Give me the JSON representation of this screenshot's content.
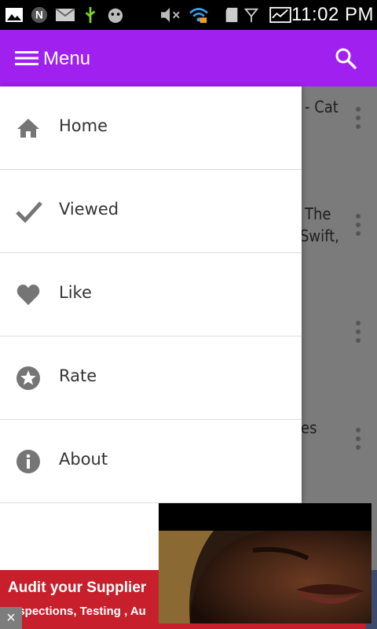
{
  "status_bar": {
    "time": "11:02 PM",
    "icons": [
      "image-icon",
      "n-icon",
      "mail-icon",
      "usb-icon",
      "android-debug-icon",
      "mute-icon",
      "wifi-icon",
      "sd-card-icon",
      "signal-icon",
      "activity-icon"
    ]
  },
  "app_bar": {
    "title": "Menu",
    "color": "#A020F0"
  },
  "drawer": {
    "items": [
      {
        "label": "Home",
        "icon": "home-icon"
      },
      {
        "label": "Viewed",
        "icon": "check-icon"
      },
      {
        "label": "Like",
        "icon": "heart-icon"
      },
      {
        "label": "Rate",
        "icon": "star-icon"
      },
      {
        "label": "About",
        "icon": "info-icon"
      }
    ]
  },
  "background_list": {
    "fragments": [
      "- Cat",
      "The",
      "Swift,",
      "es"
    ]
  },
  "ad_banner": {
    "title": "Audit your Supplier",
    "subtitle": "Inspections, Testing , Au",
    "close": "×",
    "color": "#C7202C"
  }
}
